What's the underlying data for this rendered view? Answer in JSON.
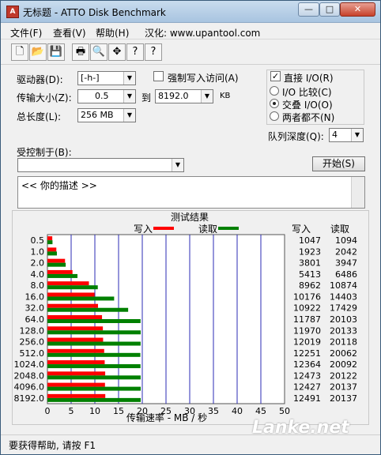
{
  "window": {
    "title": "无标题 - ATTO Disk Benchmark",
    "app_icon_glyph": "A"
  },
  "titlebar_buttons": {
    "minimize": "—",
    "maximize": "□",
    "close": "✕"
  },
  "menu": [
    "文件(F)",
    "查看(V)",
    "帮助(H)",
    "汉化: www.upantool.com"
  ],
  "toolbar": [
    {
      "name": "new-file-icon",
      "glyph": "🗋"
    },
    {
      "name": "open-folder-icon",
      "glyph": "📂"
    },
    {
      "name": "save-icon",
      "glyph": "💾"
    },
    {
      "name": "print-icon",
      "glyph": "🖶"
    },
    {
      "name": "print-preview-icon",
      "glyph": "🔍"
    },
    {
      "name": "move-icon",
      "glyph": "✥"
    },
    {
      "name": "help-icon",
      "glyph": "?"
    },
    {
      "name": "context-help-icon",
      "glyph": "?"
    }
  ],
  "form": {
    "drive_label": "驱动器(D):",
    "drive_value": "[-h-]",
    "force_write_label": "强制写入访问(A)",
    "transfer_size_label": "传输大小(Z):",
    "transfer_from": "0.5",
    "to_label": "到",
    "transfer_to": "8192.0",
    "kb_label": "KB",
    "total_length_label": "总长度(L):",
    "total_length_value": "256 MB",
    "controlled_by_label": "受控制于(B):",
    "controlled_by_value": "",
    "description": "<<  你的描述  >>"
  },
  "io_options": {
    "direct_io_label": "直接 I/O(R)",
    "direct_io_checked": true,
    "radios": [
      {
        "label": "I/O 比较(C)",
        "selected": false
      },
      {
        "label": "交叠 I/O(O)",
        "selected": true
      },
      {
        "label": "两者都不(N)",
        "selected": false
      }
    ],
    "queue_depth_label": "队列深度(Q):",
    "queue_depth_value": "4"
  },
  "start_button": "开始(S)",
  "results": {
    "group_title": "测试结果",
    "write_col": "写入",
    "read_col": "读取"
  },
  "chart_data": {
    "type": "bar",
    "orientation": "horizontal",
    "legend": [
      {
        "name": "写入",
        "color": "#ff0000"
      },
      {
        "name": "读取",
        "color": "#008000"
      }
    ],
    "categories": [
      "0.5",
      "1.0",
      "2.0",
      "4.0",
      "8.0",
      "16.0",
      "32.0",
      "64.0",
      "128.0",
      "256.0",
      "512.0",
      "1024.0",
      "2048.0",
      "4096.0",
      "8192.0"
    ],
    "series": [
      {
        "name": "写入",
        "color": "#ff0000",
        "values": [
          1047,
          1923,
          3801,
          5413,
          8962,
          10176,
          10922,
          11787,
          11970,
          12019,
          12251,
          12364,
          12473,
          12427,
          12491
        ]
      },
      {
        "name": "读取",
        "color": "#008000",
        "values": [
          1094,
          2042,
          3947,
          6486,
          10874,
          14403,
          17429,
          20103,
          20133,
          20118,
          20062,
          20092,
          20122,
          20137,
          20137
        ]
      }
    ],
    "xlim": [
      0,
      50
    ],
    "xticks": [
      "0",
      "5",
      "10",
      "15",
      "20",
      "25",
      "30",
      "35",
      "40",
      "45",
      "50"
    ],
    "xlabel": "传输速率 - MB / 秒",
    "grid": true
  },
  "status_text": "要获得帮助, 请按 F1",
  "watermark": "Lanke.net"
}
